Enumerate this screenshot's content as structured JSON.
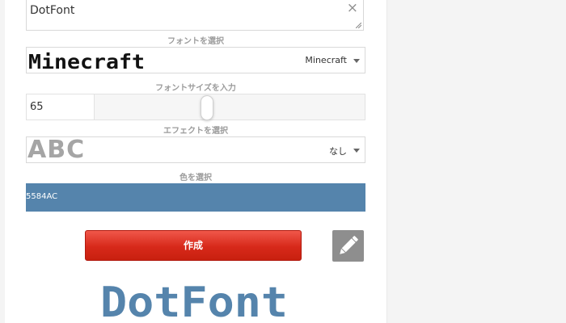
{
  "text_input": {
    "value": "DotFont",
    "clear_icon": "×"
  },
  "font_select": {
    "label": "フォントを選択",
    "selected": "Minecraft",
    "preview_text": "Minecraft"
  },
  "font_size": {
    "label": "フォントサイズを入力",
    "value": "65",
    "slider_fraction": 0.41
  },
  "effect_select": {
    "label": "エフェクトを選択",
    "selected": "なし",
    "preview_text": "ABC"
  },
  "color_select": {
    "label": "色を選択",
    "hex_text": "5584AC",
    "color": "#5584AC"
  },
  "actions": {
    "create_label": "作成",
    "edit_icon": "pencil-icon"
  },
  "result": {
    "text": "DotFont",
    "color": "#5584AC"
  },
  "colors": {
    "accent_red": "#d7291a",
    "edit_grey": "#8e8e8e",
    "label_grey": "#9b9b9b"
  }
}
